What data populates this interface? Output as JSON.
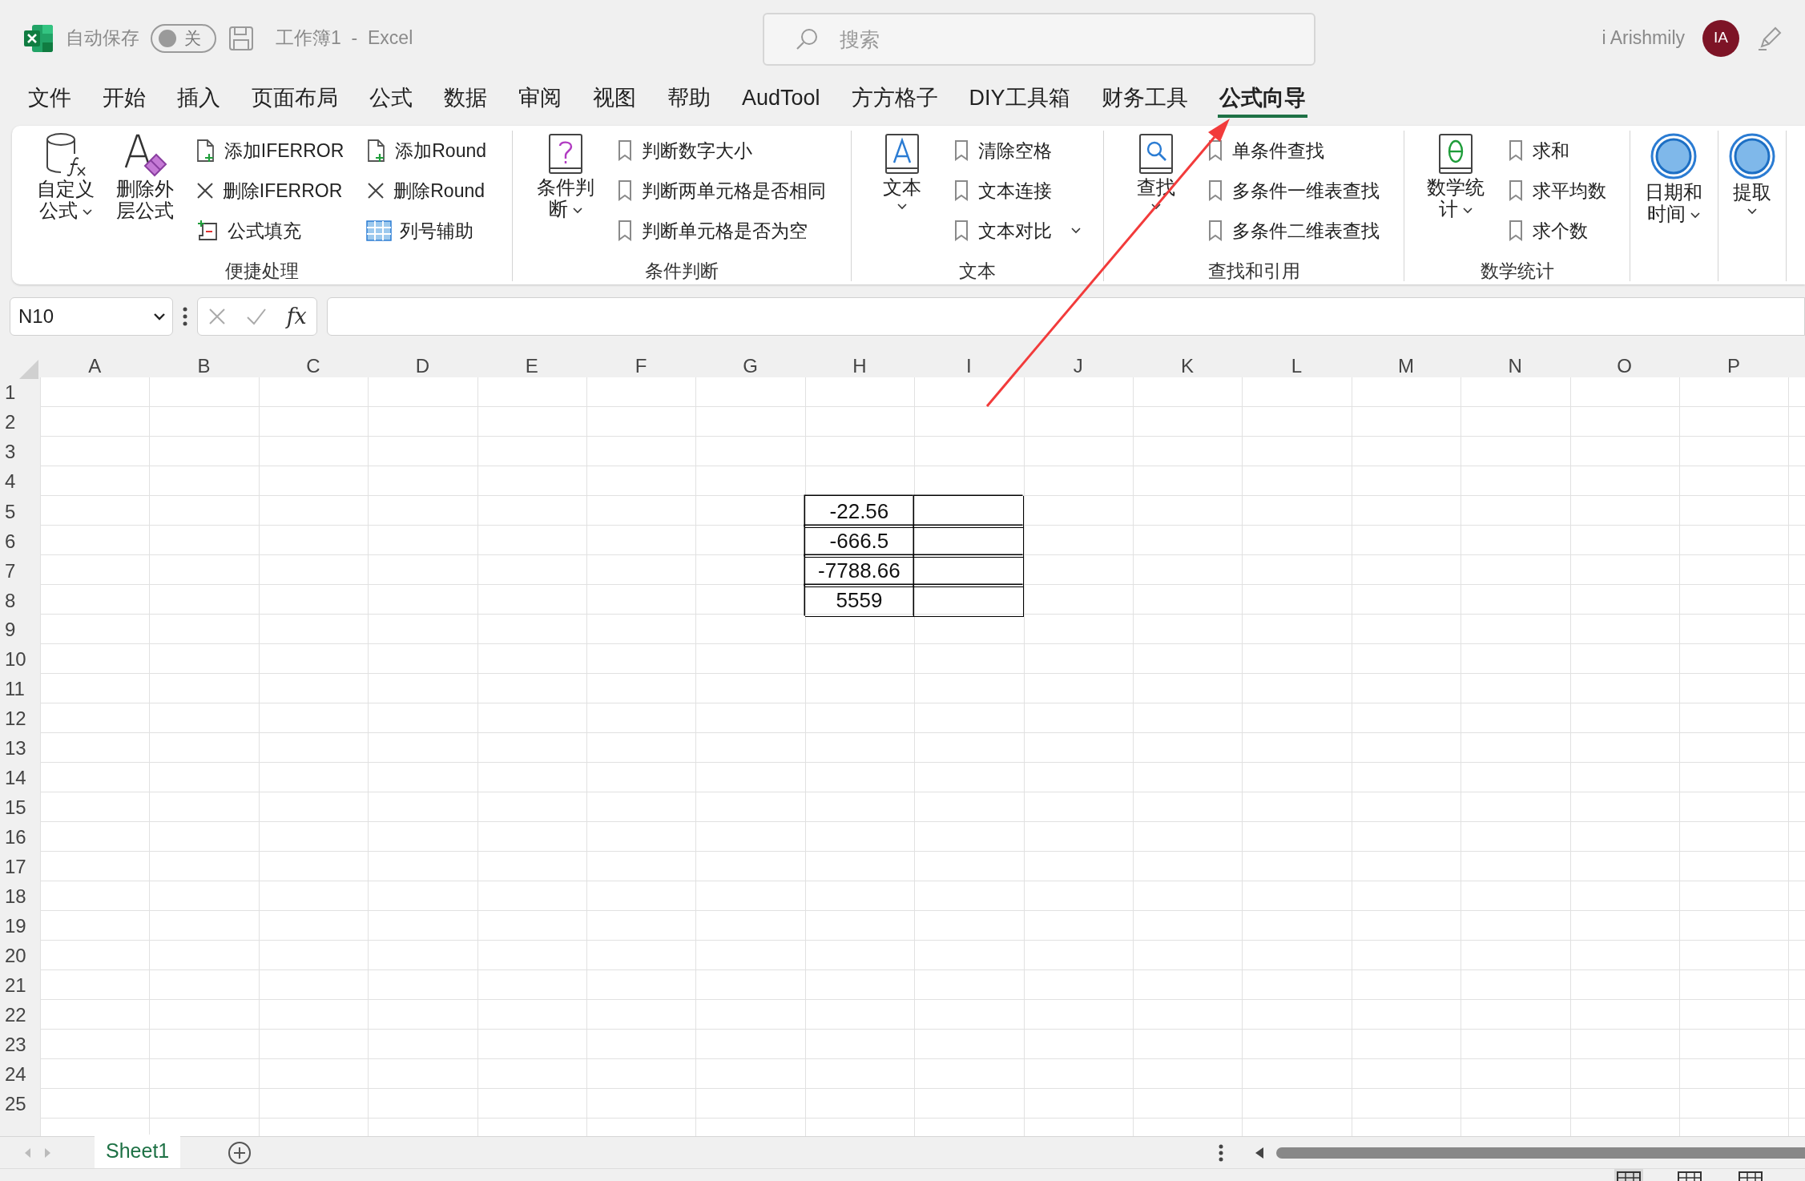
{
  "title_bar": {
    "autosave_label": "自动保存",
    "autosave": {
      "on": false,
      "label": "关"
    },
    "document_title": "工作簿1  -  Excel",
    "search_placeholder": "搜索",
    "user_name": "i Arishmily",
    "avatar_initials": "IA"
  },
  "tabs": [
    {
      "label": "文件",
      "selected": false
    },
    {
      "label": "开始",
      "selected": false
    },
    {
      "label": "插入",
      "selected": false
    },
    {
      "label": "页面布局",
      "selected": false
    },
    {
      "label": "公式",
      "selected": false
    },
    {
      "label": "数据",
      "selected": false
    },
    {
      "label": "审阅",
      "selected": false
    },
    {
      "label": "视图",
      "selected": false
    },
    {
      "label": "帮助",
      "selected": false
    },
    {
      "label": "AudTool",
      "selected": false
    },
    {
      "label": "方方格子",
      "selected": false
    },
    {
      "label": "DIY工具箱",
      "selected": false
    },
    {
      "label": "财务工具",
      "selected": false
    },
    {
      "label": "公式向导",
      "selected": true
    }
  ],
  "ribbon": {
    "groups": [
      {
        "label": "便捷处理",
        "items": [
          {
            "kind": "large",
            "label": "自定义公式",
            "dropdown": true
          },
          {
            "kind": "large",
            "label": "删除外层公式",
            "dropdown": false
          },
          {
            "kind": "small",
            "label": "添加IFERROR",
            "dropdown": false
          },
          {
            "kind": "small",
            "label": "删除IFERROR",
            "dropdown": false
          },
          {
            "kind": "small",
            "label": "公式填充",
            "dropdown": false
          },
          {
            "kind": "small",
            "label": "添加Round",
            "dropdown": false
          },
          {
            "kind": "small",
            "label": "删除Round",
            "dropdown": false
          },
          {
            "kind": "small",
            "label": "列号辅助",
            "dropdown": false
          }
        ]
      },
      {
        "label": "条件判断",
        "items": [
          {
            "kind": "large",
            "label": "条件判断",
            "dropdown": true
          },
          {
            "kind": "small",
            "label": "判断数字大小",
            "dropdown": false
          },
          {
            "kind": "small",
            "label": "判断两单元格是否相同",
            "dropdown": false
          },
          {
            "kind": "small",
            "label": "判断单元格是否为空",
            "dropdown": false
          }
        ]
      },
      {
        "label": "文本",
        "items": [
          {
            "kind": "large",
            "label": "文本",
            "dropdown": true
          },
          {
            "kind": "small",
            "label": "清除空格",
            "dropdown": false
          },
          {
            "kind": "small",
            "label": "文本连接",
            "dropdown": false
          },
          {
            "kind": "small",
            "label": "文本对比",
            "dropdown": true
          }
        ]
      },
      {
        "label": "查找和引用",
        "items": [
          {
            "kind": "large",
            "label": "查找",
            "dropdown": true
          },
          {
            "kind": "small",
            "label": "单条件查找",
            "dropdown": false
          },
          {
            "kind": "small",
            "label": "多条件一维表查找",
            "dropdown": false
          },
          {
            "kind": "small",
            "label": "多条件二维表查找",
            "dropdown": false
          }
        ]
      },
      {
        "label": "数学统计",
        "items": [
          {
            "kind": "large",
            "label": "数学统计",
            "dropdown": true
          },
          {
            "kind": "small",
            "label": "求和",
            "dropdown": false
          },
          {
            "kind": "small",
            "label": "求平均数",
            "dropdown": false
          },
          {
            "kind": "small",
            "label": "求个数",
            "dropdown": false
          }
        ]
      },
      {
        "items": [
          {
            "kind": "large",
            "label": "日期和时间",
            "dropdown": true
          }
        ]
      },
      {
        "items": [
          {
            "kind": "large",
            "label": "提取",
            "dropdown": true
          }
        ]
      }
    ]
  },
  "formula_bar": {
    "name_box": "N10",
    "function_symbol": "fx"
  },
  "sheet": {
    "columns": [
      "A",
      "B",
      "C",
      "D",
      "E",
      "F",
      "G",
      "H",
      "I",
      "J",
      "K",
      "L",
      "M",
      "N",
      "O",
      "P"
    ],
    "rows": [
      {
        "header": "1"
      },
      {
        "header": "2"
      },
      {
        "header": "3"
      },
      {
        "header": "4"
      },
      {
        "header": "5",
        "cells": [
          null,
          null,
          null,
          null,
          null,
          null,
          null,
          {
            "value": "-22.56",
            "bordered": true
          },
          {
            "bordered": true
          }
        ]
      },
      {
        "header": "6",
        "cells": [
          null,
          null,
          null,
          null,
          null,
          null,
          null,
          {
            "value": "-666.5",
            "bordered": true
          },
          {
            "bordered": true
          }
        ]
      },
      {
        "header": "7",
        "cells": [
          null,
          null,
          null,
          null,
          null,
          null,
          null,
          {
            "value": "-7788.66",
            "bordered": true
          },
          {
            "bordered": true
          }
        ]
      },
      {
        "header": "8",
        "cells": [
          null,
          null,
          null,
          null,
          null,
          null,
          null,
          {
            "value": "5559",
            "bordered": true
          },
          {
            "bordered": true
          }
        ]
      },
      {
        "header": "9"
      },
      {
        "header": "10"
      },
      {
        "header": "11"
      },
      {
        "header": "12"
      },
      {
        "header": "13"
      },
      {
        "header": "14"
      },
      {
        "header": "15"
      },
      {
        "header": "16"
      },
      {
        "header": "17"
      },
      {
        "header": "18"
      },
      {
        "header": "19"
      },
      {
        "header": "20"
      },
      {
        "header": "21"
      },
      {
        "header": "22"
      },
      {
        "header": "23"
      },
      {
        "header": "24"
      },
      {
        "header": "25"
      }
    ]
  },
  "sheet_tabs": [
    {
      "label": "Sheet1",
      "selected": true
    }
  ]
}
